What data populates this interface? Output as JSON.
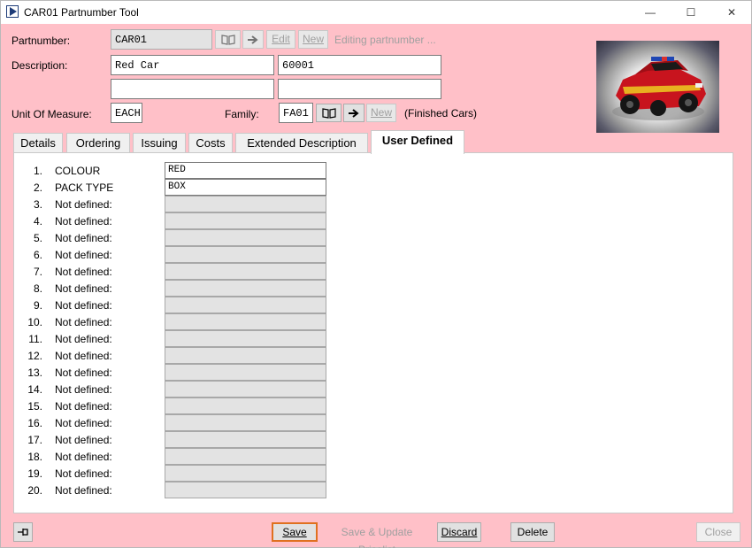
{
  "window": {
    "title": "CAR01 Partnumber Tool",
    "minimize": "—",
    "maximize": "☐",
    "close": "✕"
  },
  "header": {
    "partnumber_label": "Partnumber:",
    "partnumber_value": "CAR01",
    "edit_label": "Edit",
    "new_label": "New",
    "status_text": "Editing partnumber ...",
    "description_label": "Description:",
    "description_1": "Red Car",
    "description_2": "60001",
    "description_3": "",
    "description_4": "",
    "uom_label": "Unit Of Measure:",
    "uom_value": "EACH",
    "family_label": "Family:",
    "family_value": "FA01",
    "family_new_label": "New",
    "family_name": "(Finished Cars)"
  },
  "icons": {
    "lookup": "book-icon",
    "go": "arrow-right-icon",
    "pin": "pin-icon"
  },
  "tabs": [
    {
      "label": "Details"
    },
    {
      "label": "Ordering"
    },
    {
      "label": "Issuing"
    },
    {
      "label": "Costs"
    },
    {
      "label": "Extended Description"
    },
    {
      "label": "User Defined",
      "active": true
    }
  ],
  "user_defined": [
    {
      "num": "1.",
      "label": "COLOUR",
      "value": "RED"
    },
    {
      "num": "2.",
      "label": "PACK TYPE",
      "value": "BOX"
    },
    {
      "num": "3.",
      "label": "Not defined:",
      "value": ""
    },
    {
      "num": "4.",
      "label": "Not defined:",
      "value": ""
    },
    {
      "num": "5.",
      "label": "Not defined:",
      "value": ""
    },
    {
      "num": "6.",
      "label": "Not defined:",
      "value": ""
    },
    {
      "num": "7.",
      "label": "Not defined:",
      "value": ""
    },
    {
      "num": "8.",
      "label": "Not defined:",
      "value": ""
    },
    {
      "num": "9.",
      "label": "Not defined:",
      "value": ""
    },
    {
      "num": "10.",
      "label": "Not defined:",
      "value": ""
    },
    {
      "num": "11.",
      "label": "Not defined:",
      "value": ""
    },
    {
      "num": "12.",
      "label": "Not defined:",
      "value": ""
    },
    {
      "num": "13.",
      "label": "Not defined:",
      "value": ""
    },
    {
      "num": "14.",
      "label": "Not defined:",
      "value": ""
    },
    {
      "num": "15.",
      "label": "Not defined:",
      "value": ""
    },
    {
      "num": "16.",
      "label": "Not defined:",
      "value": ""
    },
    {
      "num": "17.",
      "label": "Not defined:",
      "value": ""
    },
    {
      "num": "18.",
      "label": "Not defined:",
      "value": ""
    },
    {
      "num": "19.",
      "label": "Not defined:",
      "value": ""
    },
    {
      "num": "20.",
      "label": "Not defined:",
      "value": ""
    }
  ],
  "footer": {
    "save_label": "Save",
    "save_update_label": "Save & Update Pricelist",
    "discard_label": "Discard",
    "delete_label": "Delete",
    "close_label": "Close"
  },
  "colors": {
    "window_bg": "#ffc0c8",
    "focus_border": "#e07020",
    "disabled_text": "#a0a0a0"
  }
}
